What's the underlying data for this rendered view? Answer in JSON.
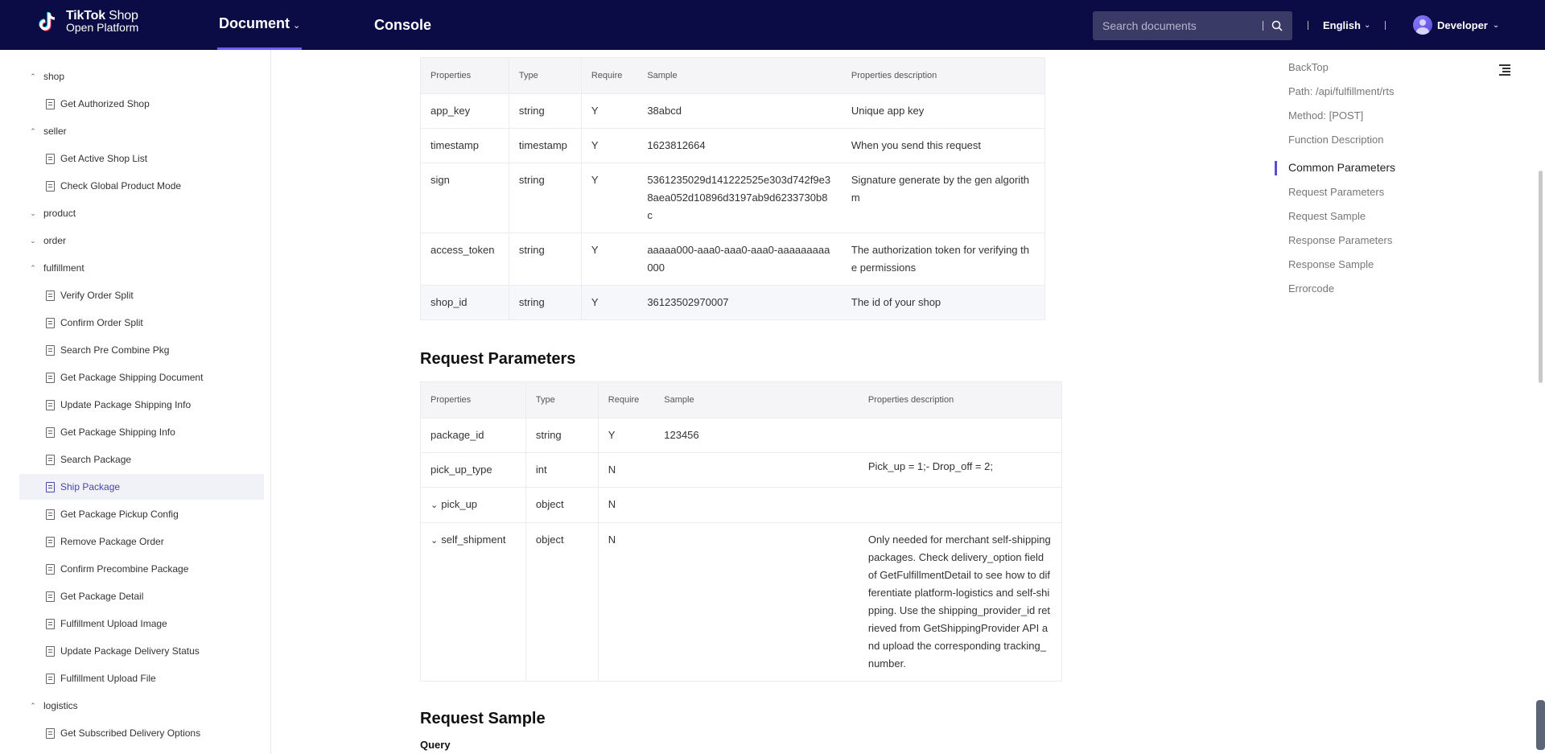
{
  "header": {
    "logo_line1_bold": "TikTok",
    "logo_line1_rest": "Shop",
    "logo_line2": "Open Platform",
    "nav_document": "Document",
    "nav_console": "Console",
    "search_placeholder": "Search documents",
    "language": "English",
    "user": "Developer"
  },
  "sidebar": {
    "groups": {
      "shop": "shop",
      "seller": "seller",
      "product": "product",
      "order": "order",
      "fulfillment": "fulfillment",
      "logistics": "logistics"
    },
    "items": {
      "get_authorized_shop": "Get Authorized Shop",
      "get_active_shop_list": "Get Active Shop List",
      "check_global_product_mode": "Check Global Product Mode",
      "verify_order_split": "Verify Order Split",
      "confirm_order_split": "Confirm Order Split",
      "search_pre_combine_pkg": "Search Pre Combine Pkg",
      "get_package_shipping_document": "Get Package Shipping Document",
      "update_package_shipping_info": "Update Package Shipping Info",
      "get_package_shipping_info": "Get Package Shipping Info",
      "search_package": "Search Package",
      "ship_package": "Ship Package",
      "get_package_pickup_config": "Get Package Pickup Config",
      "remove_package_order": "Remove Package Order",
      "confirm_precombine_package": "Confirm Precombine Package",
      "get_package_detail": "Get Package Detail",
      "fulfillment_upload_image": "Fulfillment Upload Image",
      "update_package_delivery_status": "Update Package Delivery Status",
      "fulfillment_upload_file": "Fulfillment Upload File",
      "get_subscribed_delivery_options": "Get Subscribed Delivery Options"
    }
  },
  "columns": {
    "properties": "Properties",
    "type": "Type",
    "require": "Require",
    "sample": "Sample",
    "description": "Properties description"
  },
  "common_params": [
    {
      "name": "app_key",
      "type": "string",
      "require": "Y",
      "sample": "38abcd",
      "desc": "Unique app key"
    },
    {
      "name": "timestamp",
      "type": "timestamp",
      "require": "Y",
      "sample": "1623812664",
      "desc": "When you send this request"
    },
    {
      "name": "sign",
      "type": "string",
      "require": "Y",
      "sample": "5361235029d141222525e303d742f9e38aea052d10896d3197ab9d6233730b8c",
      "desc": "Signature generate by the gen algorithm"
    },
    {
      "name": "access_token",
      "type": "string",
      "require": "Y",
      "sample": "aaaaa000-aaa0-aaa0-aaa0-aaaaaaaaa000",
      "desc": "The authorization token for verifying the permissions"
    },
    {
      "name": "shop_id",
      "type": "string",
      "require": "Y",
      "sample": "36123502970007",
      "desc": "The id of your shop"
    }
  ],
  "request_section_title": "Request Parameters",
  "request_params": [
    {
      "name": "package_id",
      "type": "string",
      "require": "Y",
      "sample": "123456",
      "desc": ""
    },
    {
      "name": "pick_up_type",
      "type": "int",
      "require": "N",
      "sample": "",
      "desc": "Pick_up = 1;- Drop_off = 2;"
    },
    {
      "name": "pick_up",
      "type": "object",
      "require": "N",
      "sample": "",
      "desc": ""
    },
    {
      "name": "self_shipment",
      "type": "object",
      "require": "N",
      "sample": "",
      "desc": "Only needed for merchant self-shipping packages. Check delivery_option field of GetFulfillmentDetail to see how to differentiate platform-logistics and self-shipping. Use the shipping_provider_id retrieved from GetShippingProvider API and upload the corresponding tracking_number."
    }
  ],
  "request_sample_title": "Request Sample",
  "query_label": "Query",
  "toc": {
    "back_top": "BackTop",
    "path": "Path: /api/fulfillment/rts",
    "method": "Method: [POST]",
    "function_description": "Function Description",
    "common_parameters": "Common Parameters",
    "request_parameters": "Request Parameters",
    "request_sample": "Request Sample",
    "response_parameters": "Response Parameters",
    "response_sample": "Response Sample",
    "errorcode": "Errorcode"
  },
  "colors": {
    "header_bg": "#0b0b45",
    "accent": "#5b4cd6",
    "active_item": "#4a45a8"
  }
}
